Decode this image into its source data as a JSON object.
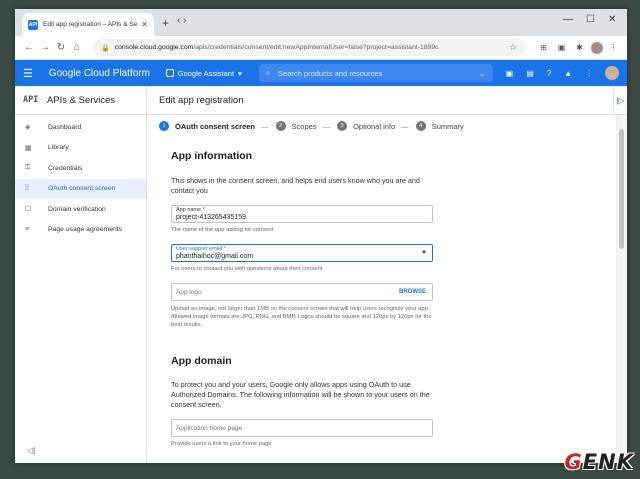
{
  "browser": {
    "tab_title": "Edit app registration – APIs & Se",
    "tab_favicon_text": "API",
    "url_domain": "console.cloud.google.com",
    "url_path": "/apis/credentials/consent/edit;newAppInternalUser=false?project=assistant-1899c"
  },
  "header": {
    "product_title": "Google Cloud Platform",
    "project_name": "Google Assistant",
    "search_placeholder": "Search products and resources"
  },
  "sidebar": {
    "api_badge": "API",
    "title": "APIs & Services",
    "items": [
      {
        "label": "Dashboard",
        "icon": "◈"
      },
      {
        "label": "Library",
        "icon": "▦"
      },
      {
        "label": "Credentials",
        "icon": "⚿"
      },
      {
        "label": "OAuth consent screen",
        "icon": "⁞⁞"
      },
      {
        "label": "Domain verification",
        "icon": "☐"
      },
      {
        "label": "Page usage agreements",
        "icon": "≡"
      }
    ],
    "active_index": 3
  },
  "page": {
    "title": "Edit app registration",
    "steps": [
      {
        "num": "1",
        "label": "OAuth consent screen"
      },
      {
        "num": "2",
        "label": "Scopes"
      },
      {
        "num": "3",
        "label": "Optional info"
      },
      {
        "num": "4",
        "label": "Summary"
      }
    ]
  },
  "app_information": {
    "heading": "App information",
    "description": "This shows in the consent screen, and helps end users know who you are and contact you",
    "app_name_label": "App name *",
    "app_name_value": "project-413265435159",
    "app_name_helper": "The name of the app asking for consent",
    "support_email_label": "User support email *",
    "support_email_value": "phanthaihoc@gmail.com",
    "support_email_helper": "For users to contact you with questions about their consent",
    "logo_placeholder": "App logo",
    "browse_label": "BROWSE",
    "logo_helper": "Upload an image, not larger than 1MB on the consent screen that will help users recognize your app. Allowed image formats are JPG, PNG, and BMP. Logos should be square and 120px by 120px for the best results."
  },
  "app_domain": {
    "heading": "App domain",
    "description": "To protect you and your users, Google only allows apps using OAuth to use Authorized Domains. The following information will be shown to your users on the consent screen.",
    "home_page_placeholder": "Application home page",
    "home_page_helper": "Provide users a link to your home page"
  },
  "watermark": {
    "g": "G",
    "rest": "ENK"
  }
}
